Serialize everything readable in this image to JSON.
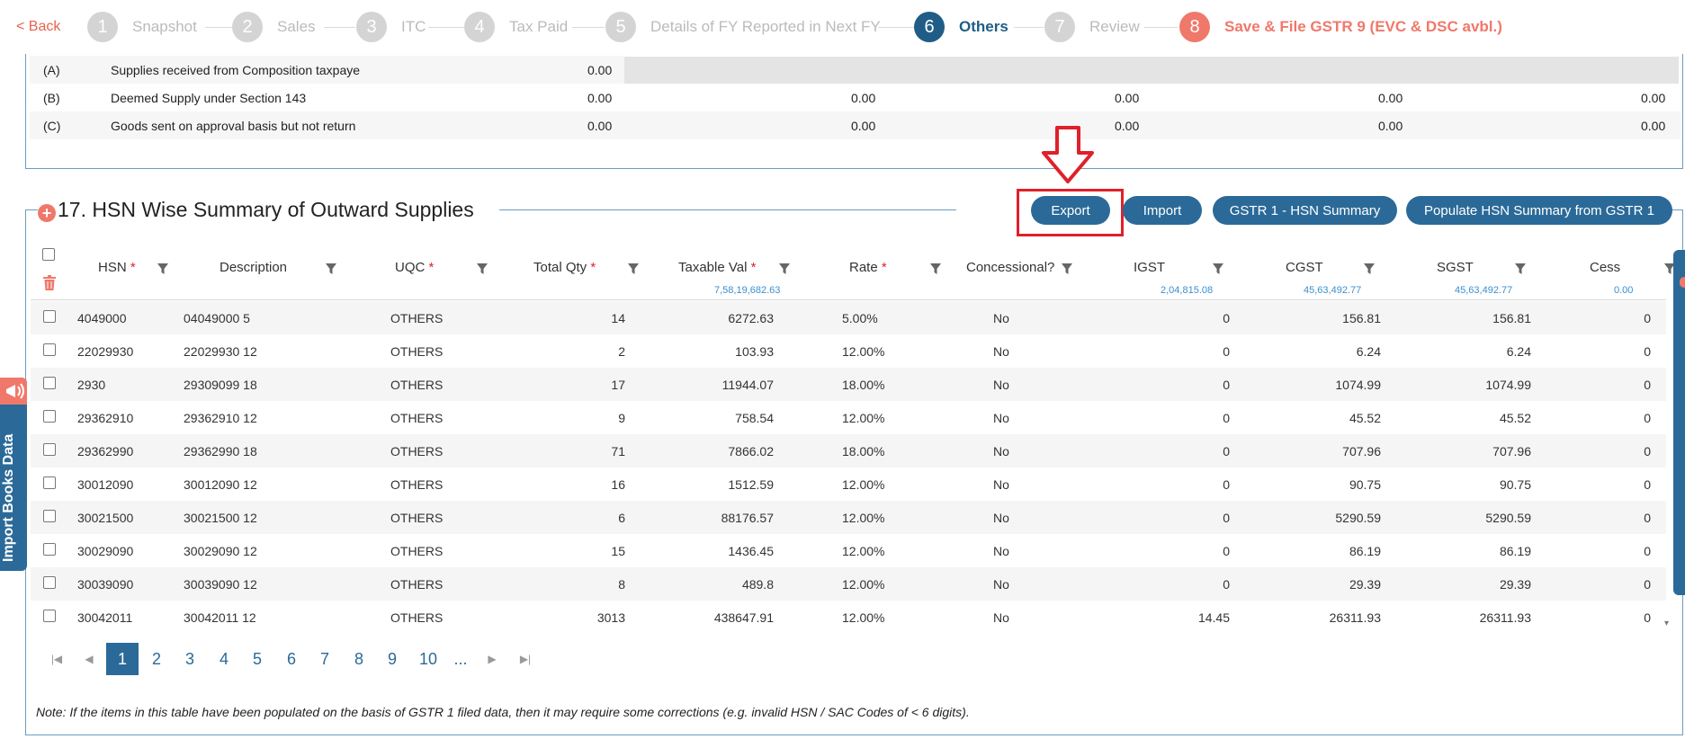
{
  "stepper": {
    "back_label": "< Back",
    "steps": [
      {
        "num": "1",
        "label": "Snapshot"
      },
      {
        "num": "2",
        "label": "Sales"
      },
      {
        "num": "3",
        "label": "ITC"
      },
      {
        "num": "4",
        "label": "Tax Paid"
      },
      {
        "num": "5",
        "label": "Details of FY Reported in Next FY"
      },
      {
        "num": "6",
        "label": "Others"
      },
      {
        "num": "7",
        "label": "Review"
      },
      {
        "num": "8",
        "label": "Save & File GSTR 9 (EVC & DSC avbl.)"
      }
    ],
    "active_step": "6"
  },
  "top_table": {
    "rows": [
      {
        "code": "(A)",
        "desc": "Supplies received from Composition taxpaye",
        "v1": "0.00",
        "v2": "",
        "v3": "",
        "v4": "",
        "v5": ""
      },
      {
        "code": "(B)",
        "desc": "Deemed Supply under Section 143",
        "v1": "0.00",
        "v2": "0.00",
        "v3": "0.00",
        "v4": "0.00",
        "v5": "0.00"
      },
      {
        "code": "(C)",
        "desc": "Goods sent on approval basis but not return",
        "v1": "0.00",
        "v2": "0.00",
        "v3": "0.00",
        "v4": "0.00",
        "v5": "0.00"
      }
    ]
  },
  "section": {
    "title": "17. HSN Wise Summary of Outward Supplies",
    "buttons": {
      "export": "Export",
      "import": "Import",
      "gstr1_hsn": "GSTR 1 - HSN Summary",
      "populate": "Populate HSN Summary from GSTR 1"
    }
  },
  "grid": {
    "columns": {
      "hsn": "HSN",
      "description": "Description",
      "uqc": "UQC",
      "total_qty": "Total Qty",
      "taxable_val": "Taxable Val",
      "rate": "Rate",
      "concessional": "Concessional?",
      "igst": "IGST",
      "cgst": "CGST",
      "sgst": "SGST",
      "cess": "Cess"
    },
    "required_mark": "*",
    "totals": {
      "taxable_val": "7,58,19,682.63",
      "igst": "2,04,815.08",
      "cgst": "45,63,492.77",
      "sgst": "45,63,492.77",
      "cess": "0.00"
    },
    "rows": [
      {
        "hsn": "4049000",
        "desc": "04049000 5",
        "uqc": "OTHERS",
        "qty": "14",
        "val": "6272.63",
        "rate": "5.00%",
        "conc": "No",
        "igst": "0",
        "cgst": "156.81",
        "sgst": "156.81",
        "cess": "0"
      },
      {
        "hsn": "22029930",
        "desc": "22029930 12",
        "uqc": "OTHERS",
        "qty": "2",
        "val": "103.93",
        "rate": "12.00%",
        "conc": "No",
        "igst": "0",
        "cgst": "6.24",
        "sgst": "6.24",
        "cess": "0"
      },
      {
        "hsn": "2930",
        "desc": "29309099 18",
        "uqc": "OTHERS",
        "qty": "17",
        "val": "11944.07",
        "rate": "18.00%",
        "conc": "No",
        "igst": "0",
        "cgst": "1074.99",
        "sgst": "1074.99",
        "cess": "0"
      },
      {
        "hsn": "29362910",
        "desc": "29362910 12",
        "uqc": "OTHERS",
        "qty": "9",
        "val": "758.54",
        "rate": "12.00%",
        "conc": "No",
        "igst": "0",
        "cgst": "45.52",
        "sgst": "45.52",
        "cess": "0"
      },
      {
        "hsn": "29362990",
        "desc": "29362990 18",
        "uqc": "OTHERS",
        "qty": "71",
        "val": "7866.02",
        "rate": "18.00%",
        "conc": "No",
        "igst": "0",
        "cgst": "707.96",
        "sgst": "707.96",
        "cess": "0"
      },
      {
        "hsn": "30012090",
        "desc": "30012090 12",
        "uqc": "OTHERS",
        "qty": "16",
        "val": "1512.59",
        "rate": "12.00%",
        "conc": "No",
        "igst": "0",
        "cgst": "90.75",
        "sgst": "90.75",
        "cess": "0"
      },
      {
        "hsn": "30021500",
        "desc": "30021500 12",
        "uqc": "OTHERS",
        "qty": "6",
        "val": "88176.57",
        "rate": "12.00%",
        "conc": "No",
        "igst": "0",
        "cgst": "5290.59",
        "sgst": "5290.59",
        "cess": "0"
      },
      {
        "hsn": "30029090",
        "desc": "30029090 12",
        "uqc": "OTHERS",
        "qty": "15",
        "val": "1436.45",
        "rate": "12.00%",
        "conc": "No",
        "igst": "0",
        "cgst": "86.19",
        "sgst": "86.19",
        "cess": "0"
      },
      {
        "hsn": "30039090",
        "desc": "30039090 12",
        "uqc": "OTHERS",
        "qty": "8",
        "val": "489.8",
        "rate": "12.00%",
        "conc": "No",
        "igst": "0",
        "cgst": "29.39",
        "sgst": "29.39",
        "cess": "0"
      },
      {
        "hsn": "30042011",
        "desc": "30042011 12",
        "uqc": "OTHERS",
        "qty": "3013",
        "val": "438647.91",
        "rate": "12.00%",
        "conc": "No",
        "igst": "14.45",
        "cgst": "26311.93",
        "sgst": "26311.93",
        "cess": "0"
      }
    ]
  },
  "pagination": {
    "pages": [
      "1",
      "2",
      "3",
      "4",
      "5",
      "6",
      "7",
      "8",
      "9",
      "10",
      "..."
    ],
    "current": "1"
  },
  "note": "Note: If the items in this table have been populated on the basis of GSTR 1 filed data, then it may require some corrections (e.g. invalid HSN / SAC Codes of < 6 digits).",
  "side_tab": {
    "label": "Import Books Data"
  },
  "colors": {
    "primary": "#2b6a98",
    "accent": "#f0786b",
    "highlight": "#e0202a"
  },
  "icons": [
    "plus-circle-icon",
    "filter-icon",
    "trash-icon",
    "down-arrow-icon",
    "megaphone-icon",
    "first-page-icon",
    "prev-page-icon",
    "next-page-icon",
    "last-page-icon"
  ]
}
